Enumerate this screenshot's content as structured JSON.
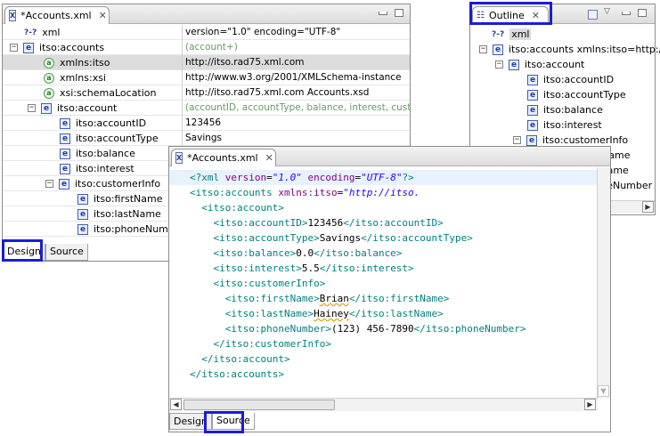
{
  "design_editor": {
    "tab_title": "*Accounts.xml",
    "rows": [
      {
        "icon": "pi",
        "name": "xml",
        "value": "version=\"1.0\" encoding=\"UTF-8\"",
        "depth": 0,
        "expander": "",
        "value_style": "normal"
      },
      {
        "icon": "element",
        "name": "itso:accounts",
        "value": "(account+)",
        "depth": 0,
        "expander": "−",
        "value_style": "gray"
      },
      {
        "icon": "attribute",
        "name": "xmlns:itso",
        "value": "http://itso.rad75.xml.com",
        "depth": 1,
        "expander": "",
        "value_style": "normal",
        "selected": true
      },
      {
        "icon": "attribute",
        "name": "xmlns:xsi",
        "value": "http://www.w3.org/2001/XMLSchema-instance",
        "depth": 1,
        "expander": "",
        "value_style": "normal"
      },
      {
        "icon": "attribute",
        "name": "xsi:schemaLocation",
        "value": "http://itso.rad75.xml.com Accounts.xsd",
        "depth": 1,
        "expander": "",
        "value_style": "normal"
      },
      {
        "icon": "element",
        "name": "itso:account",
        "value": "(accountID, accountType, balance, interest, custom",
        "depth": 1,
        "expander": "−",
        "value_style": "gray"
      },
      {
        "icon": "element",
        "name": "itso:accountID",
        "value": "123456",
        "depth": 2,
        "expander": "",
        "value_style": "normal"
      },
      {
        "icon": "element",
        "name": "itso:accountType",
        "value": "Savings",
        "depth": 2,
        "expander": "",
        "value_style": "normal"
      },
      {
        "icon": "element",
        "name": "itso:balance",
        "value": "",
        "depth": 2,
        "expander": "",
        "value_style": "normal"
      },
      {
        "icon": "element",
        "name": "itso:interest",
        "value": "",
        "depth": 2,
        "expander": "",
        "value_style": "normal"
      },
      {
        "icon": "element",
        "name": "itso:customerInfo",
        "value": "",
        "depth": 2,
        "expander": "−",
        "value_style": "normal"
      },
      {
        "icon": "element",
        "name": "itso:firstName",
        "value": "",
        "depth": 3,
        "expander": "",
        "value_style": "normal"
      },
      {
        "icon": "element",
        "name": "itso:lastName",
        "value": "",
        "depth": 3,
        "expander": "",
        "value_style": "normal"
      },
      {
        "icon": "element",
        "name": "itso:phoneNumber",
        "value": "",
        "depth": 3,
        "expander": "",
        "value_style": "normal"
      }
    ],
    "bottom_tabs": {
      "design": "Design",
      "source": "Source"
    }
  },
  "source_editor": {
    "tab_title": "*Accounts.xml",
    "lines": [
      [
        {
          "t": "<?xml ",
          "c": "pi"
        },
        {
          "t": "version",
          "c": "attr"
        },
        {
          "t": "=",
          "c": "txt"
        },
        {
          "t": "\"1.0\"",
          "c": "str"
        },
        {
          "t": " encoding",
          "c": "attr"
        },
        {
          "t": "=",
          "c": "txt"
        },
        {
          "t": "\"UTF-8\"",
          "c": "str"
        },
        {
          "t": "?>",
          "c": "pi"
        }
      ],
      [
        {
          "t": "<itso:accounts ",
          "c": "tag"
        },
        {
          "t": "xmlns:itso",
          "c": "attr"
        },
        {
          "t": "=",
          "c": "txt"
        },
        {
          "t": "\"http://itso.",
          "c": "str"
        }
      ],
      [
        {
          "t": "  <itso:account>",
          "c": "tag"
        }
      ],
      [
        {
          "t": "    <itso:accountID>",
          "c": "tag"
        },
        {
          "t": "123456",
          "c": "txt"
        },
        {
          "t": "</itso:accountID>",
          "c": "tag"
        }
      ],
      [
        {
          "t": "    <itso:accountType>",
          "c": "tag"
        },
        {
          "t": "Savings",
          "c": "txt"
        },
        {
          "t": "</itso:accountType>",
          "c": "tag"
        }
      ],
      [
        {
          "t": "    <itso:balance>",
          "c": "tag"
        },
        {
          "t": "0.0",
          "c": "txt"
        },
        {
          "t": "</itso:balance>",
          "c": "tag"
        }
      ],
      [
        {
          "t": "    <itso:interest>",
          "c": "tag"
        },
        {
          "t": "5.5",
          "c": "txt"
        },
        {
          "t": "</itso:interest>",
          "c": "tag"
        }
      ],
      [
        {
          "t": "    <itso:customerInfo>",
          "c": "tag"
        }
      ],
      [
        {
          "t": "      <itso:firstName>",
          "c": "tag"
        },
        {
          "t": "Brian",
          "c": "txt squig"
        },
        {
          "t": "</itso:firstName>",
          "c": "tag"
        }
      ],
      [
        {
          "t": "      <itso:lastName>",
          "c": "tag"
        },
        {
          "t": "Hainey",
          "c": "txt squig"
        },
        {
          "t": "</itso:lastName>",
          "c": "tag"
        }
      ],
      [
        {
          "t": "      <itso:phoneNumber>",
          "c": "tag"
        },
        {
          "t": "(123) 456-7890",
          "c": "txt"
        },
        {
          "t": "</itso:phoneNumber>",
          "c": "tag"
        }
      ],
      [
        {
          "t": "    </itso:customerInfo>",
          "c": "tag"
        }
      ],
      [
        {
          "t": "  </itso:account>",
          "c": "tag"
        }
      ],
      [
        {
          "t": "</itso:accounts>",
          "c": "tag"
        }
      ]
    ],
    "bottom_tabs": {
      "design": "Design",
      "source": "Source"
    }
  },
  "outline": {
    "tab_title": "Outline",
    "items": [
      {
        "icon": "pi",
        "label": "xml",
        "depth": 0,
        "expander": "",
        "highlight": true
      },
      {
        "icon": "element",
        "label": "itso:accounts xmlns:itso=http://it",
        "depth": 0,
        "expander": "−"
      },
      {
        "icon": "element",
        "label": "itso:account",
        "depth": 1,
        "expander": "−"
      },
      {
        "icon": "element",
        "label": "itso:accountID",
        "depth": 2,
        "expander": ""
      },
      {
        "icon": "element",
        "label": "itso:accountType",
        "depth": 2,
        "expander": ""
      },
      {
        "icon": "element",
        "label": "itso:balance",
        "depth": 2,
        "expander": ""
      },
      {
        "icon": "element",
        "label": "itso:interest",
        "depth": 2,
        "expander": ""
      },
      {
        "icon": "element",
        "label": "itso:customerInfo",
        "depth": 2,
        "expander": "−"
      },
      {
        "icon": "element",
        "label": "itso:firstName",
        "depth": 3,
        "expander": ""
      },
      {
        "icon": "element",
        "label": "itso:lastName",
        "depth": 3,
        "expander": ""
      },
      {
        "icon": "element",
        "label": "itso:phoneNumber",
        "depth": 3,
        "expander": ""
      }
    ]
  },
  "icons": {
    "pi_glyph": "?-?",
    "element_glyph": "e",
    "attribute_glyph": "a",
    "file_glyph": "X",
    "close_glyph": "✕"
  },
  "colors": {
    "callout": "#1c1cd6",
    "tag": "#008080",
    "attribute": "#7f007f",
    "string": "#2a00ff"
  }
}
